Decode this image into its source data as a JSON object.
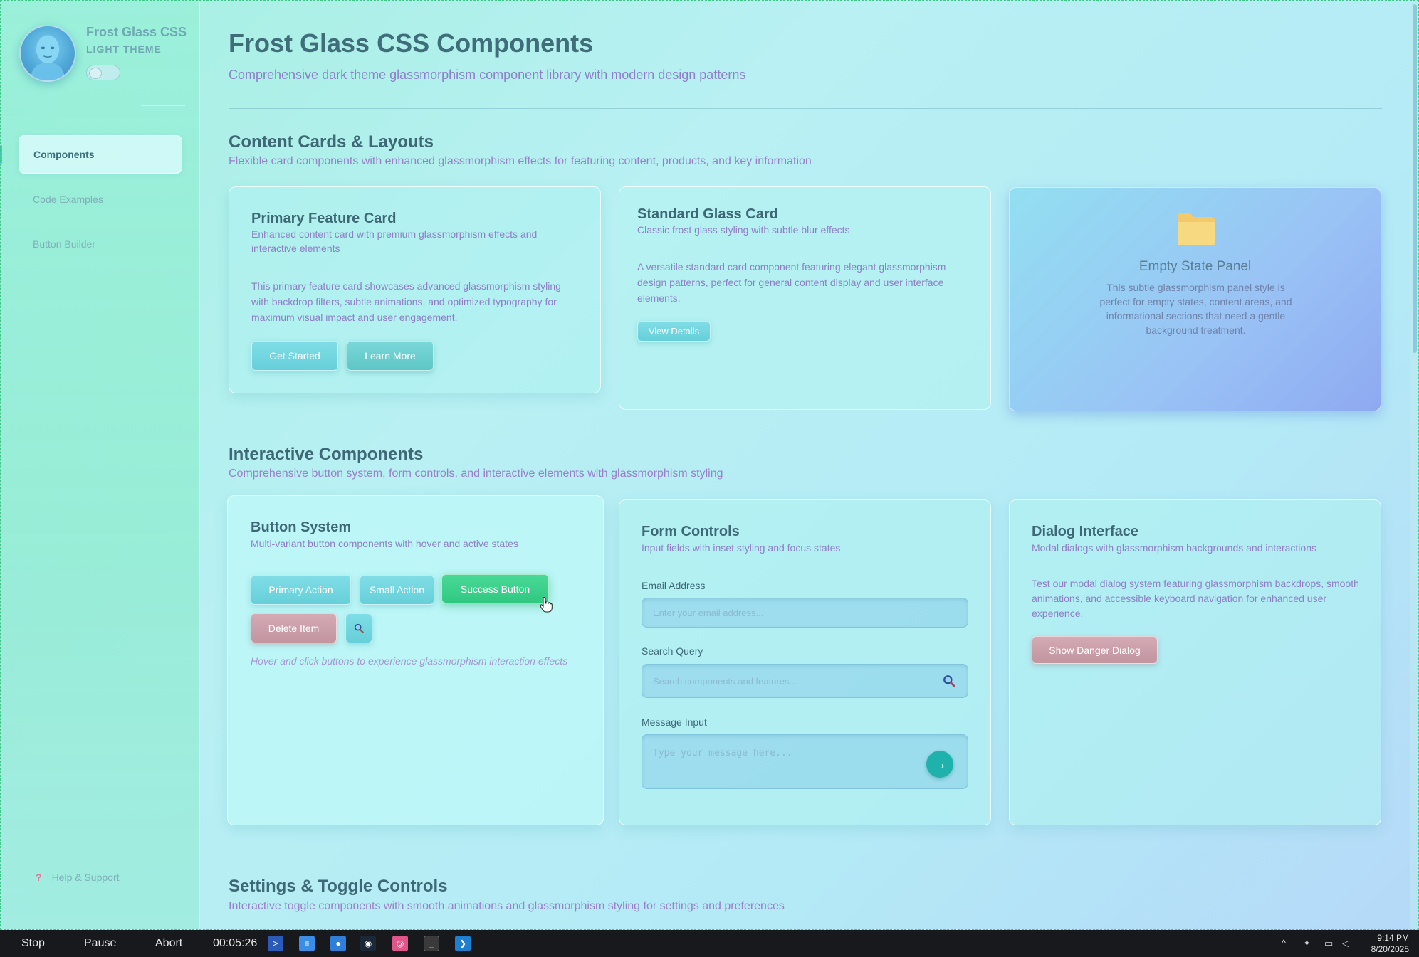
{
  "sidebar": {
    "brand": "Frost Glass CSS",
    "theme_label": "LIGHT THEME",
    "nav": [
      {
        "label": "Components"
      },
      {
        "label": "Code Examples"
      },
      {
        "label": "Button Builder"
      }
    ],
    "help": "Help & Support"
  },
  "header": {
    "title": "Frost Glass CSS Components",
    "subtitle": "Comprehensive dark theme glassmorphism component library with modern design patterns"
  },
  "sections": {
    "cards": {
      "title": "Content Cards & Layouts",
      "desc": "Flexible card components with enhanced glassmorphism effects for featuring content, products, and key information"
    },
    "interactive": {
      "title": "Interactive Components",
      "desc": "Comprehensive button system, form controls, and interactive elements with glassmorphism styling"
    },
    "settings": {
      "title": "Settings & Toggle Controls",
      "desc": "Interactive toggle components with smooth animations and glassmorphism styling for settings and preferences"
    }
  },
  "primary_card": {
    "title": "Primary Feature Card",
    "sub": "Enhanced content card with premium glassmorphism effects and interactive elements",
    "body": "This primary feature card showcases advanced glassmorphism styling with backdrop filters, subtle animations, and optimized typography for maximum visual impact and user engagement.",
    "btn_get_started": "Get Started",
    "btn_learn_more": "Learn More"
  },
  "standard_card": {
    "title": "Standard Glass Card",
    "sub": "Classic frost glass styling with subtle blur effects",
    "body": "A versatile standard card component featuring elegant glassmorphism design patterns, perfect for general content display and user interface elements.",
    "btn_view": "View Details"
  },
  "empty_panel": {
    "icon": "folder-icon",
    "title": "Empty State Panel",
    "body": "This subtle glassmorphism panel style is perfect for empty states, content areas, and informational sections that need a gentle background treatment."
  },
  "button_system": {
    "title": "Button System",
    "sub": "Multi-variant button components with hover and active states",
    "primary": "Primary Action",
    "small": "Small Action",
    "success": "Success Button",
    "delete": "Delete Item",
    "note": "Hover and click buttons to experience glassmorphism interaction effects"
  },
  "form_controls": {
    "title": "Form Controls",
    "sub": "Input fields with inset styling and focus states",
    "email_label": "Email Address",
    "email_placeholder": "Enter your email address...",
    "search_label": "Search Query",
    "search_placeholder": "Search components and features...",
    "message_label": "Message Input",
    "message_placeholder": "Type your message here..."
  },
  "dialog": {
    "title": "Dialog Interface",
    "sub": "Modal dialogs with glassmorphism backgrounds and interactions",
    "body": "Test our modal dialog system featuring glassmorphism backdrops, smooth animations, and accessible keyboard navigation for enhanced user experience.",
    "btn": "Show Danger Dialog"
  },
  "taskbar": {
    "stop": "Stop",
    "pause": "Pause",
    "abort": "Abort",
    "timer": "00:05:26",
    "time": "9:14 PM",
    "date": "8/20/2025"
  },
  "colors": {
    "accent": "#66cfd9",
    "success": "#31c882",
    "danger": "#c2959f",
    "text_heading": "#3e6876",
    "text_muted": "#8f7fc6"
  }
}
